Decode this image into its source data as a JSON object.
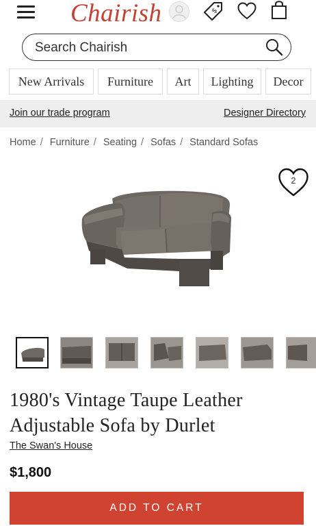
{
  "header": {
    "logo": "Chairish",
    "menu_icon": "hamburger-menu-icon",
    "account_icon": "user-avatar-icon",
    "sale_icon": "price-tag-icon",
    "favorites_icon": "heart-icon",
    "cart_icon": "shopping-bag-icon"
  },
  "search": {
    "placeholder": "Search Chairish",
    "icon": "search-icon"
  },
  "categories": [
    "New Arrivals",
    "Furniture",
    "Art",
    "Lighting",
    "Decor"
  ],
  "trade_bar": {
    "trade_link": "Join our trade program",
    "directory_link": "Designer Directory"
  },
  "breadcrumb": [
    "Home",
    "Furniture",
    "Seating",
    "Sofas",
    "Standard Sofas"
  ],
  "favorite": {
    "count": "2",
    "icon": "heart-outline-icon"
  },
  "product": {
    "title": "1980's Vintage Taupe Leather Adjustable Sofa by Durlet",
    "seller": "The Swan's House",
    "price": "$1,800"
  },
  "thumbnails_count": 7,
  "actions": {
    "add_to_cart": "ADD TO CART"
  },
  "colors": {
    "brand": "#c24132",
    "cart_button": "#d14331",
    "trade_bar": "#eeeeee"
  }
}
